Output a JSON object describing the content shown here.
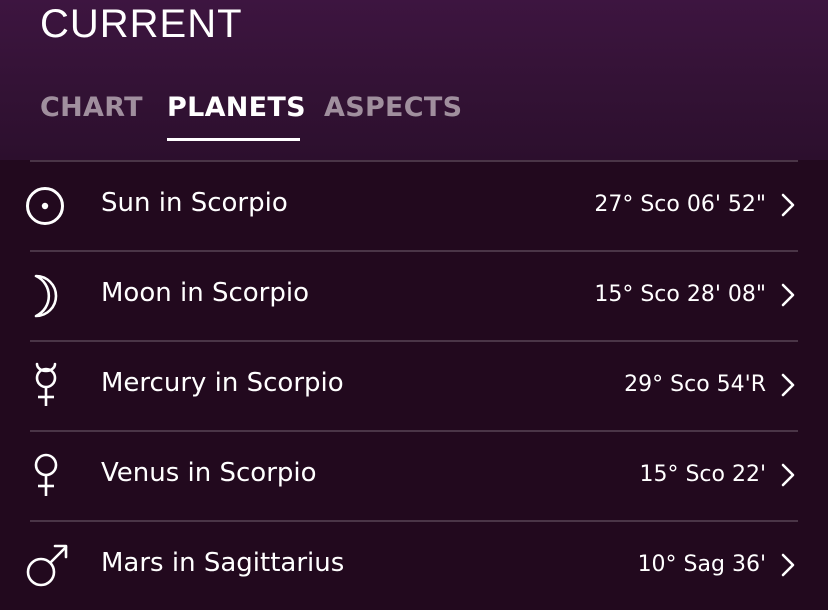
{
  "header": {
    "title": "CURRENT",
    "tabs": [
      {
        "label": "CHART",
        "active": false
      },
      {
        "label": "PLANETS",
        "active": true
      },
      {
        "label": "ASPECTS",
        "active": false
      }
    ]
  },
  "planets": [
    {
      "name": "Sun in Scorpio",
      "position": "27° Sco 06' 52\"",
      "icon": "sun-icon"
    },
    {
      "name": "Moon in Scorpio",
      "position": "15° Sco 28' 08\"",
      "icon": "moon-icon"
    },
    {
      "name": "Mercury in Scorpio",
      "position": "29° Sco 54'R",
      "icon": "mercury-icon"
    },
    {
      "name": "Venus in Scorpio",
      "position": "15° Sco 22'",
      "icon": "venus-icon"
    },
    {
      "name": "Mars in Sagittarius",
      "position": "10° Sag 36'",
      "icon": "mars-icon"
    }
  ],
  "colors": {
    "background": "#22091e",
    "header_top": "#3d1540",
    "tab_inactive": "#a08f9e",
    "divider": "#4a3547"
  }
}
